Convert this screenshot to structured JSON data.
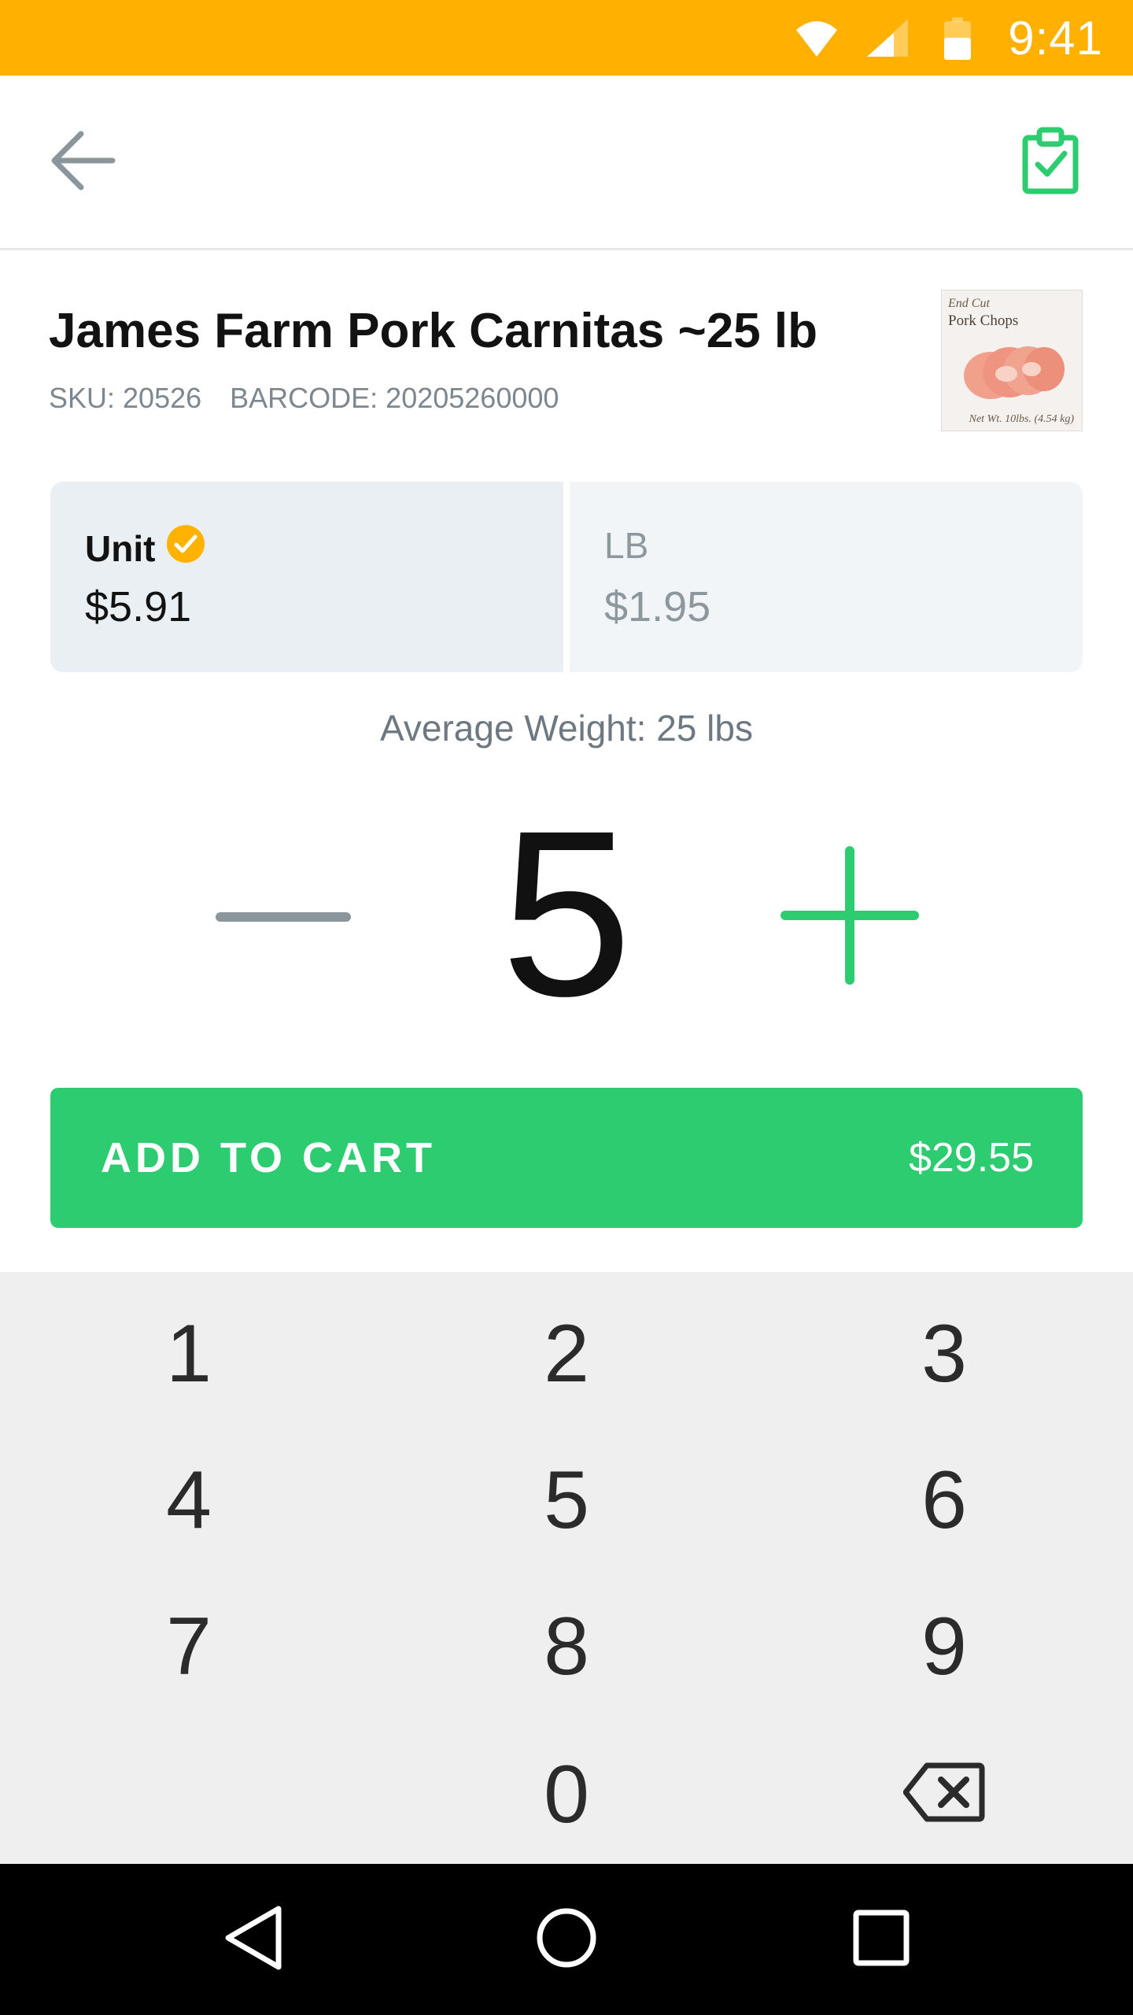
{
  "status_bar": {
    "time": "9:41",
    "icons": [
      "wifi-icon",
      "signal-icon",
      "battery-icon"
    ],
    "background_color": "#FFB000"
  },
  "app_bar": {
    "back_icon": "arrow-left-icon",
    "action_icon": "clipboard-check-icon",
    "accent_color": "#2ECC71"
  },
  "product": {
    "title": "James Farm Pork Carnitas ~25 lb",
    "sku": "SKU: 20526",
    "barcode": "BARCODE: 20205260000",
    "thumbnail": {
      "line1": "End Cut",
      "line2": "Pork Chops",
      "footer": "Net Wt. 10lbs. (4.54 kg)"
    }
  },
  "pricing": {
    "options": [
      {
        "label": "Unit",
        "price": "$5.91",
        "selected": true
      },
      {
        "label": "LB",
        "price": "$1.95",
        "selected": false
      }
    ],
    "selected_check_color": "#FFB300"
  },
  "average_weight": "Average Weight: 25 lbs",
  "quantity": {
    "value": "5",
    "minus_icon": "minus-icon",
    "plus_icon": "plus-icon"
  },
  "add_to_cart": {
    "label": "ADD TO CART",
    "total": "$29.55",
    "color": "#2ECC71"
  },
  "numpad": {
    "keys": [
      "1",
      "2",
      "3",
      "4",
      "5",
      "6",
      "7",
      "8",
      "9",
      "0"
    ],
    "backspace_icon": "backspace-icon"
  },
  "nav_bar": {
    "icons": [
      "back-triangle-icon",
      "home-circle-icon",
      "recents-square-icon"
    ]
  }
}
